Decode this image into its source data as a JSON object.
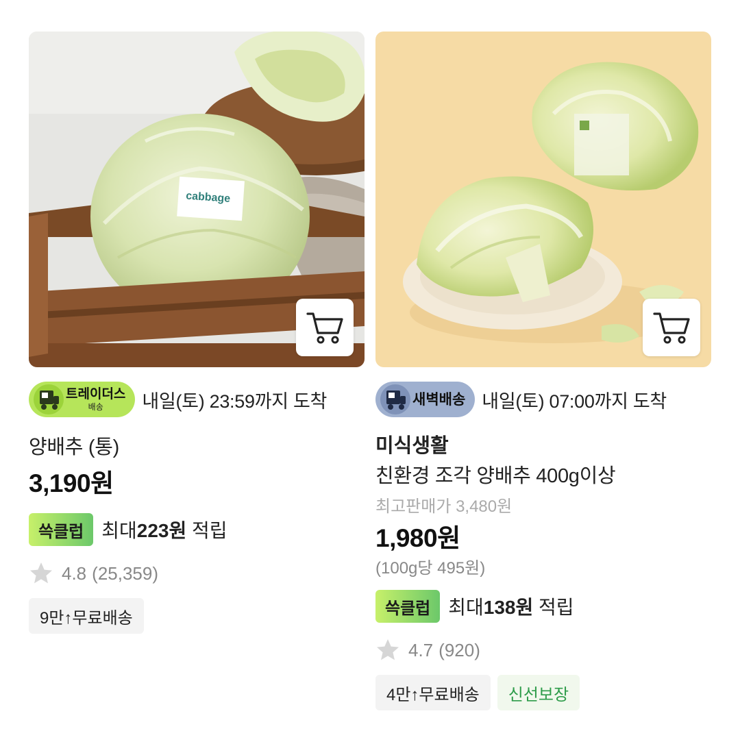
{
  "products": [
    {
      "delivery": {
        "badge_main": "트레이더스",
        "badge_sub": "배송",
        "badge_color": "#b6e55a",
        "arrival": "내일(토) 23:59까지 도착"
      },
      "image_label": "cabbage",
      "name": "양배추 (통)",
      "price": "3,190원",
      "reward": {
        "badge": "쓱클럽",
        "prefix": "최대",
        "amount": "223원",
        "suffix": " 적립"
      },
      "rating": {
        "value": "4.8",
        "count": "(25,359)"
      },
      "tags": [
        "9만↑무료배송"
      ]
    },
    {
      "delivery": {
        "badge_main": "새벽배송",
        "badge_color": "#9fb0cf",
        "arrival": "내일(토) 07:00까지 도착"
      },
      "brand": "미식생활",
      "name": "친환경 조각 양배추 400g이상",
      "original_price": "최고판매가 3,480원",
      "price": "1,980원",
      "unit_price": "(100g당 495원)",
      "reward": {
        "badge": "쓱클럽",
        "prefix": "최대",
        "amount": "138원",
        "suffix": " 적립"
      },
      "rating": {
        "value": "4.7",
        "count": "(920)"
      },
      "tags": [
        "4만↑무료배송",
        "신선보장"
      ]
    }
  ],
  "icons": [
    "cart-icon",
    "truck-icon",
    "star-icon"
  ],
  "colors": {
    "reward_gradient_start": "#c7f06a",
    "reward_gradient_end": "#6cc86a",
    "fresh_tag_text": "#2e9c4a"
  }
}
